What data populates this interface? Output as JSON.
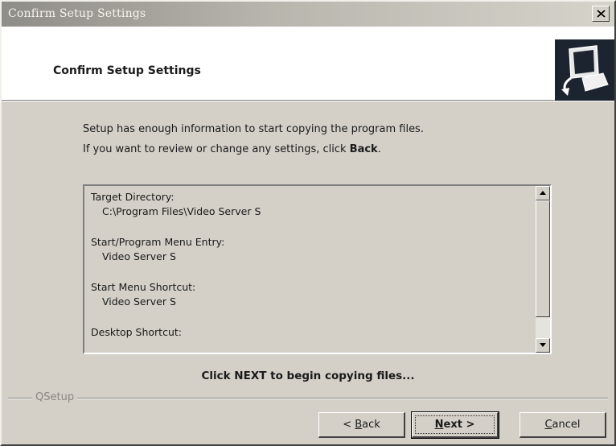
{
  "window": {
    "title": "Confirm Setup Settings"
  },
  "header": {
    "title": "Confirm Setup Settings",
    "icon": "setup-computer-icon"
  },
  "intro": {
    "line1": "Setup has enough information to start copying the program files.",
    "line2_prefix": "If you want to review or change any settings, click ",
    "line2_bold": "Back",
    "line2_suffix": "."
  },
  "settings": [
    {
      "label": "Target Directory:",
      "value": "C:\\Program Files\\Video Server S"
    },
    {
      "label": "Start/Program Menu Entry:",
      "value": "Video Server S"
    },
    {
      "label": "Start Menu Shortcut:",
      "value": "Video Server S"
    },
    {
      "label": "Desktop Shortcut:",
      "value": ""
    }
  ],
  "prompt": "Click NEXT to begin copying files...",
  "footer": {
    "group_label": "QSetup"
  },
  "buttons": {
    "back": {
      "pre": "< ",
      "mnemonic": "B",
      "post": "ack"
    },
    "next": {
      "pre": "",
      "mnemonic": "N",
      "post": "ext >"
    },
    "cancel": {
      "pre": "",
      "mnemonic": "C",
      "post": "ancel"
    }
  },
  "colors": {
    "dialog_bg": "#d4d0c8",
    "header_bg": "#ffffff",
    "logo_bg": "#1c2430"
  }
}
